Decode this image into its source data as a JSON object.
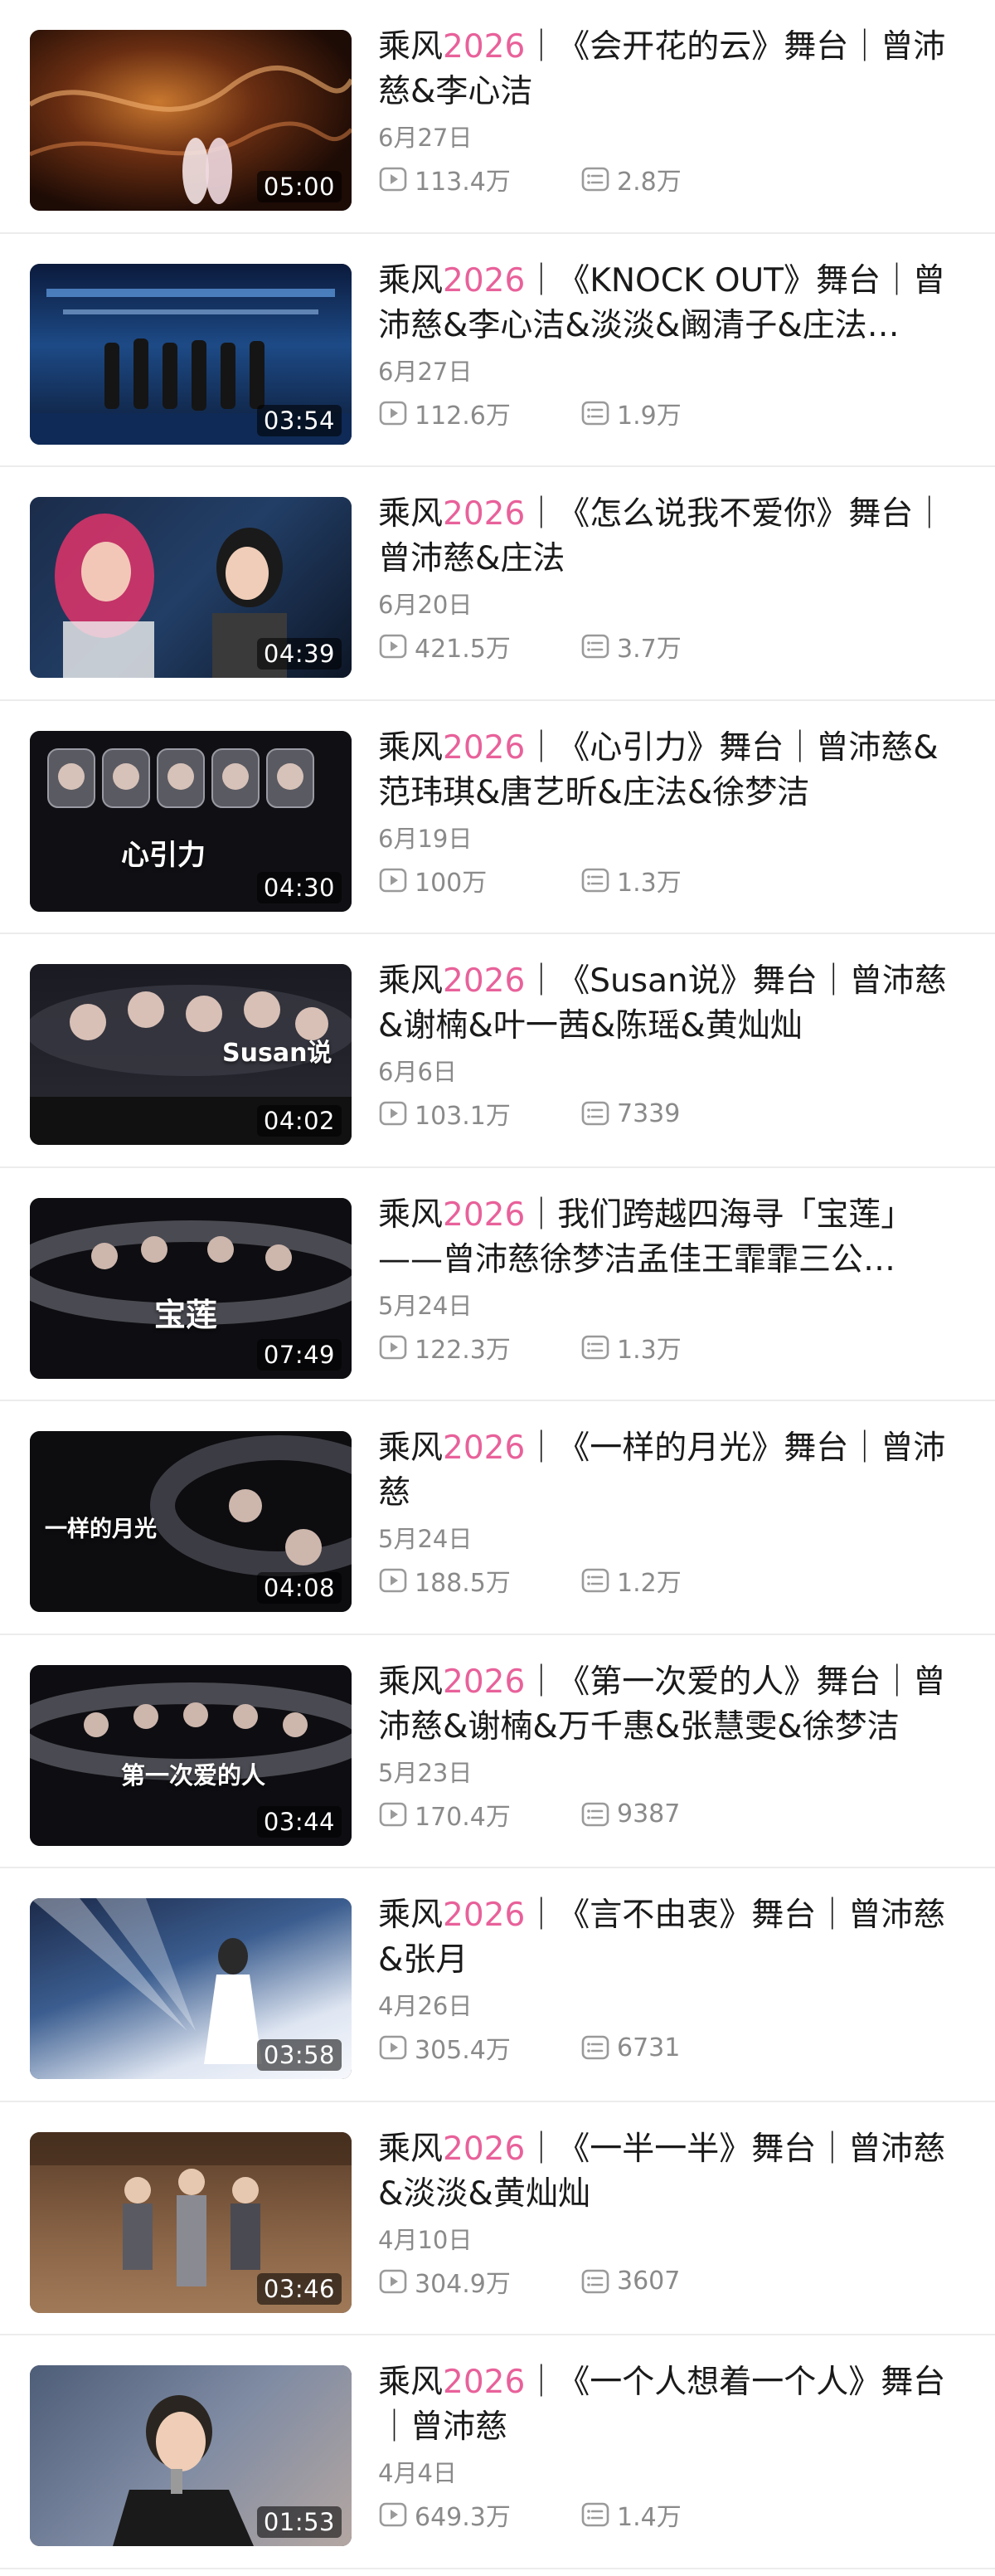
{
  "accent_color": "#e8619a",
  "icons": {
    "views": "play-square-icon",
    "danmaku": "danmaku-list-icon"
  },
  "videos": [
    {
      "title_prefix": "乘风",
      "title_year": "2026",
      "title_rest": "｜《会开花的云》舞台｜曾沛慈&李心洁",
      "date": "6月27日",
      "views": "113.4万",
      "danmaku": "2.8万",
      "duration": "05:00"
    },
    {
      "title_prefix": "乘风",
      "title_year": "2026",
      "title_rest": "｜《KNOCK OUT》舞台｜曾沛慈&李心洁&淡淡&阚清子&庄法…",
      "date": "6月27日",
      "views": "112.6万",
      "danmaku": "1.9万",
      "duration": "03:54"
    },
    {
      "title_prefix": "乘风",
      "title_year": "2026",
      "title_rest": "｜《怎么说我不爱你》舞台｜曾沛慈&庄法",
      "date": "6月20日",
      "views": "421.5万",
      "danmaku": "3.7万",
      "duration": "04:39"
    },
    {
      "title_prefix": "乘风",
      "title_year": "2026",
      "title_rest": "｜《心引力》舞台｜曾沛慈&范玮琪&唐艺昕&庄法&徐梦洁",
      "date": "6月19日",
      "views": "100万",
      "danmaku": "1.3万",
      "duration": "04:30"
    },
    {
      "title_prefix": "乘风",
      "title_year": "2026",
      "title_rest": "｜《Susan说》舞台｜曾沛慈&谢楠&叶一茜&陈瑶&黄灿灿",
      "date": "6月6日",
      "views": "103.1万",
      "danmaku": "7339",
      "duration": "04:02"
    },
    {
      "title_prefix": "乘风",
      "title_year": "2026",
      "title_rest": "｜我们跨越四海寻「宝莲」——曾沛慈徐梦洁孟佳王霏霏三公…",
      "date": "5月24日",
      "views": "122.3万",
      "danmaku": "1.3万",
      "duration": "07:49"
    },
    {
      "title_prefix": "乘风",
      "title_year": "2026",
      "title_rest": "｜《一样的月光》舞台｜曾沛慈",
      "date": "5月24日",
      "views": "188.5万",
      "danmaku": "1.2万",
      "duration": "04:08"
    },
    {
      "title_prefix": "乘风",
      "title_year": "2026",
      "title_rest": "｜《第一次爱的人》舞台｜曾沛慈&谢楠&万千惠&张慧雯&徐梦洁",
      "date": "5月23日",
      "views": "170.4万",
      "danmaku": "9387",
      "duration": "03:44"
    },
    {
      "title_prefix": "乘风",
      "title_year": "2026",
      "title_rest": "｜《言不由衷》舞台｜曾沛慈&张月",
      "date": "4月26日",
      "views": "305.4万",
      "danmaku": "6731",
      "duration": "03:58"
    },
    {
      "title_prefix": "乘风",
      "title_year": "2026",
      "title_rest": "｜《一半一半》舞台｜曾沛慈&淡淡&黄灿灿",
      "date": "4月10日",
      "views": "304.9万",
      "danmaku": "3607",
      "duration": "03:46"
    },
    {
      "title_prefix": "乘风",
      "title_year": "2026",
      "title_rest": "｜《一个人想着一个人》舞台｜曾沛慈",
      "date": "4月4日",
      "views": "649.3万",
      "danmaku": "1.4万",
      "duration": "01:53"
    }
  ],
  "thumb_overlays": {
    "v3": "心引力",
    "v4": "Susan说",
    "v5": "宝莲",
    "v6": "一样的月光",
    "v7": "第一次爱的人"
  }
}
